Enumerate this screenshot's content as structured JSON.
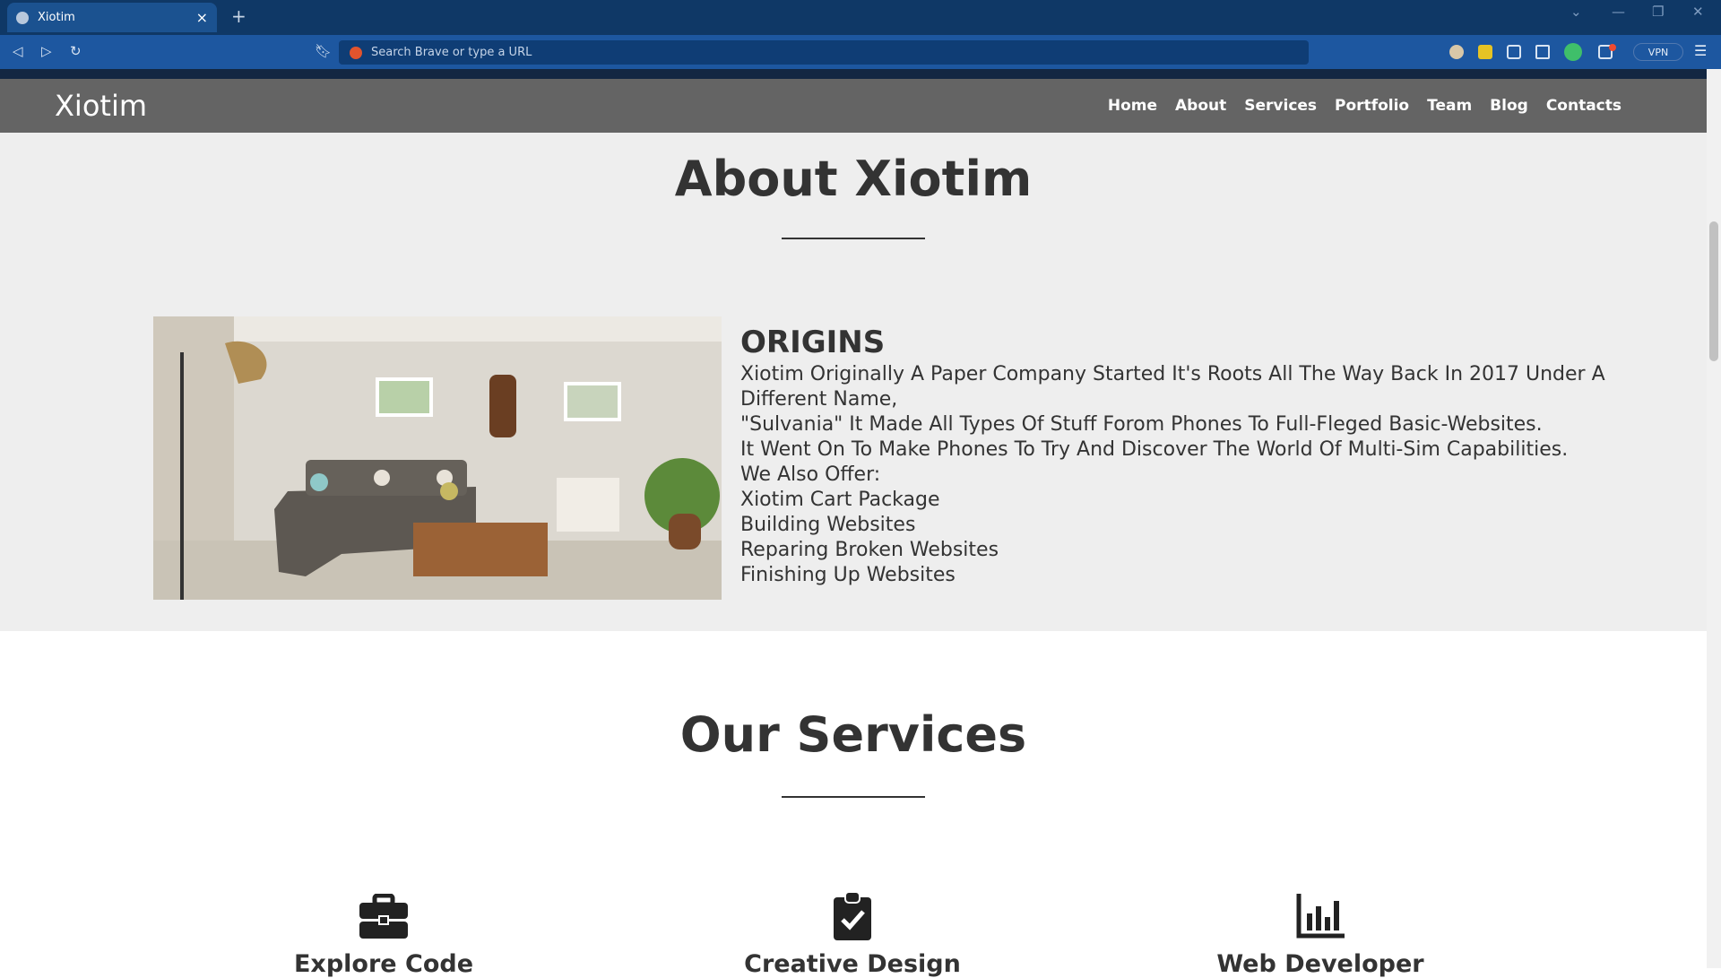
{
  "browser": {
    "tab_title": "Xiotim",
    "new_tab_symbol": "+",
    "close_symbol": "×",
    "url_placeholder": "Search Brave or type a URL",
    "vpn_label": "VPN"
  },
  "site": {
    "brand": "Xiotim",
    "nav": [
      "Home",
      "About",
      "Services",
      "Portfolio",
      "Team",
      "Blog",
      "Contacts"
    ]
  },
  "about": {
    "title": "About Xiotim",
    "heading": "ORIGINS",
    "lines": [
      "Xiotim Originally A Paper Company Started It's Roots All The Way Back In 2017 Under A Different Name,",
      "\"Sulvania\" It Made All Types Of Stuff Forom Phones To Full-Fleged Basic-Websites.",
      "It Went On To Make Phones To Try And Discover The World Of Multi-Sim Capabilities.",
      "We Also Offer:",
      "Xiotim Cart Package",
      "Building Websites",
      "Reparing Broken Websites",
      "Finishing Up Websites"
    ]
  },
  "services": {
    "title": "Our Services",
    "items": [
      {
        "label": "Explore Code",
        "icon": "briefcase-icon"
      },
      {
        "label": "Creative Design",
        "icon": "clipboard-check-icon"
      },
      {
        "label": "Web Developer",
        "icon": "bar-chart-icon"
      }
    ]
  }
}
